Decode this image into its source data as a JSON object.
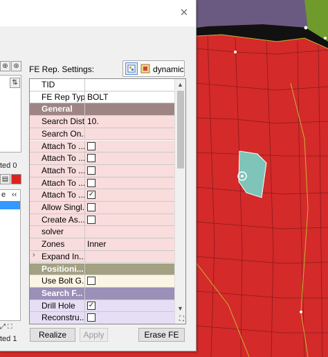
{
  "dialog": {
    "settings_label": "FE Rep. Settings:",
    "mode_label": "dynamic",
    "buttons": {
      "realize": "Realize",
      "apply": "Apply",
      "erase": "Erase FE"
    }
  },
  "left_panel": {
    "selected_top": "ted 0",
    "col_e": "e",
    "nav": "‹‹",
    "selected_bottom": "ted 1"
  },
  "grid": {
    "header": {
      "name": "TID",
      "value": ""
    },
    "rows": [
      {
        "name": "FE Rep Type",
        "value": "BOLT",
        "kind": "plain"
      },
      {
        "name": "General",
        "value": "",
        "kind": "section-general"
      },
      {
        "name": "Search Dist",
        "value": "10.",
        "kind": "pink"
      },
      {
        "name": "Search On...",
        "value": "",
        "kind": "pink"
      },
      {
        "name": "Attach To ...",
        "value": "",
        "kind": "pink",
        "checkbox": false
      },
      {
        "name": "Attach To ...",
        "value": "",
        "kind": "pink",
        "checkbox": false
      },
      {
        "name": "Attach To ...",
        "value": "",
        "kind": "pink",
        "checkbox": false
      },
      {
        "name": "Attach To ...",
        "value": "",
        "kind": "pink",
        "checkbox": false
      },
      {
        "name": "Attach To ...",
        "value": "",
        "kind": "pink",
        "checkbox": true
      },
      {
        "name": "Allow Singl...",
        "value": "",
        "kind": "pink",
        "checkbox": false
      },
      {
        "name": "Create As...",
        "value": "",
        "kind": "pink",
        "checkbox": false
      },
      {
        "name": "solver",
        "value": "",
        "kind": "pink"
      },
      {
        "name": "Zones",
        "value": "Inner",
        "kind": "pink"
      },
      {
        "name": "Expand In...",
        "value": "",
        "kind": "pink",
        "expander": true
      },
      {
        "name": "Positioni...",
        "value": "",
        "kind": "section-pos"
      },
      {
        "name": "Use Bolt G...",
        "value": "",
        "kind": "cream",
        "checkbox": false
      },
      {
        "name": "Search F...",
        "value": "",
        "kind": "section-search"
      },
      {
        "name": "Drill Hole",
        "value": "",
        "kind": "lav",
        "checkbox": true
      },
      {
        "name": "Reconstru...",
        "value": "",
        "kind": "lav",
        "checkbox": false
      }
    ]
  },
  "colors": {
    "section_general": "#9e8584",
    "section_positioning": "#a3a182",
    "section_search": "#9a90b8",
    "mesh_red": "#d42a2a",
    "mesh_green": "#6f9a2c",
    "mesh_purple": "#6a5a82",
    "bolt_teal": "#7fc4b8"
  },
  "icons": [
    "close-icon",
    "dynamic-mode-icon",
    "static-mode-icon",
    "chevron-up-icon",
    "chevron-down-icon",
    "resize-grip-icon",
    "expand-arrow-icon",
    "checkmark-icon"
  ]
}
